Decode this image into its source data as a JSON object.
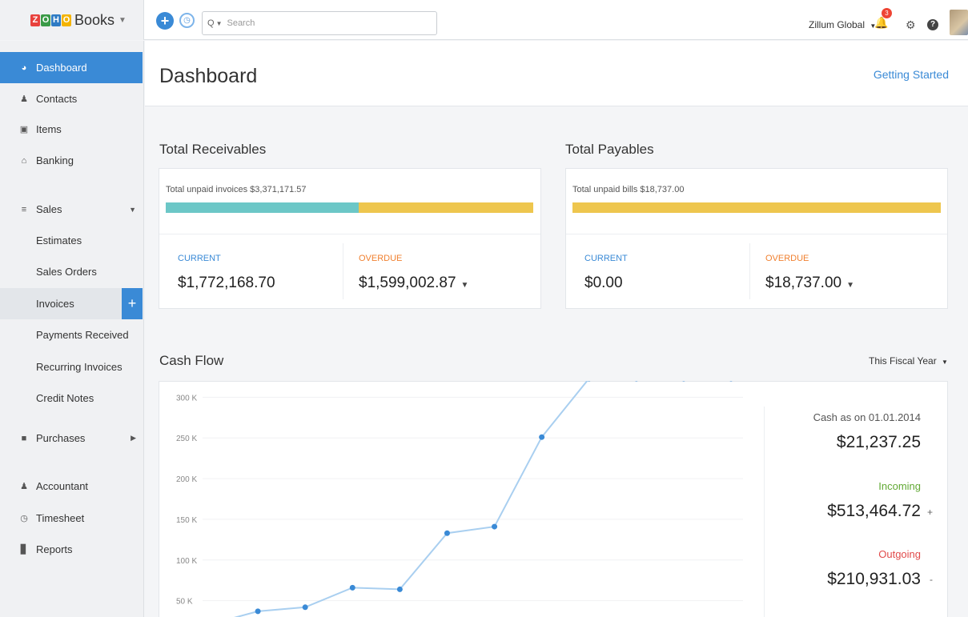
{
  "brand": {
    "logo_letters": [
      "Z",
      "O",
      "H",
      "O"
    ],
    "logo_colors": [
      "#e8413c",
      "#3a9a47",
      "#2e7bc4",
      "#f4b400"
    ],
    "name": "Books"
  },
  "topbar": {
    "search_placeholder": "Search",
    "org_name": "Zillum Global",
    "notification_count": "3"
  },
  "sidebar": {
    "items": [
      {
        "label": "Dashboard",
        "icon": "dashboard-icon"
      },
      {
        "label": "Contacts",
        "icon": "person-icon"
      },
      {
        "label": "Items",
        "icon": "box-icon"
      },
      {
        "label": "Banking",
        "icon": "bank-icon"
      },
      {
        "label": "Sales",
        "icon": "cart-icon"
      },
      {
        "label": "Estimates"
      },
      {
        "label": "Sales Orders"
      },
      {
        "label": "Invoices"
      },
      {
        "label": "Payments Received"
      },
      {
        "label": "Recurring Invoices"
      },
      {
        "label": "Credit Notes"
      },
      {
        "label": "Purchases",
        "icon": "bag-icon"
      },
      {
        "label": "Accountant",
        "icon": "accountant-icon"
      },
      {
        "label": "Timesheet",
        "icon": "timesheet-icon"
      },
      {
        "label": "Reports",
        "icon": "reports-icon"
      }
    ]
  },
  "header": {
    "title": "Dashboard",
    "getting_started": "Getting Started"
  },
  "receivables": {
    "title": "Total Receivables",
    "caption": "Total unpaid invoices $3,371,171.57",
    "current_label": "CURRENT",
    "current_amount": "$1,772,168.70",
    "overdue_label": "OVERDUE",
    "overdue_amount": "$1,599,002.87",
    "current_fraction": 0.526
  },
  "payables": {
    "title": "Total Payables",
    "caption": "Total unpaid bills $18,737.00",
    "current_label": "CURRENT",
    "current_amount": "$0.00",
    "overdue_label": "OVERDUE",
    "overdue_amount": "$18,737.00",
    "current_fraction": 0
  },
  "cashflow": {
    "title": "Cash Flow",
    "period": "This Fiscal Year",
    "cash_as_on_label": "Cash as on 01.01.2014",
    "cash_as_on_amount": "$21,237.25",
    "incoming_label": "Incoming",
    "incoming_amount": "$513,464.72",
    "incoming_sign": "+",
    "outgoing_label": "Outgoing",
    "outgoing_amount": "$210,931.03",
    "outgoing_sign": "-"
  },
  "colors": {
    "accent": "#3a8ad6",
    "receivable_current": "#6cc7c7",
    "overdue": "#eec64e",
    "incoming": "#62a935",
    "outgoing": "#e14b4b",
    "line": "#a9cff0",
    "point": "#3a8ad6"
  },
  "chart_data": {
    "type": "line",
    "y_tick_labels": [
      "50 K",
      "100 K",
      "150 K",
      "200 K",
      "250 K",
      "300 K"
    ],
    "y_ticks": [
      50000,
      100000,
      150000,
      200000,
      250000,
      300000
    ],
    "ylim": [
      30000,
      320000
    ],
    "series": [
      {
        "values": [
          21237,
          37000,
          42000,
          66000,
          64000,
          133000,
          141000,
          251000,
          323000,
          323000,
          323000,
          323000
        ]
      }
    ]
  }
}
